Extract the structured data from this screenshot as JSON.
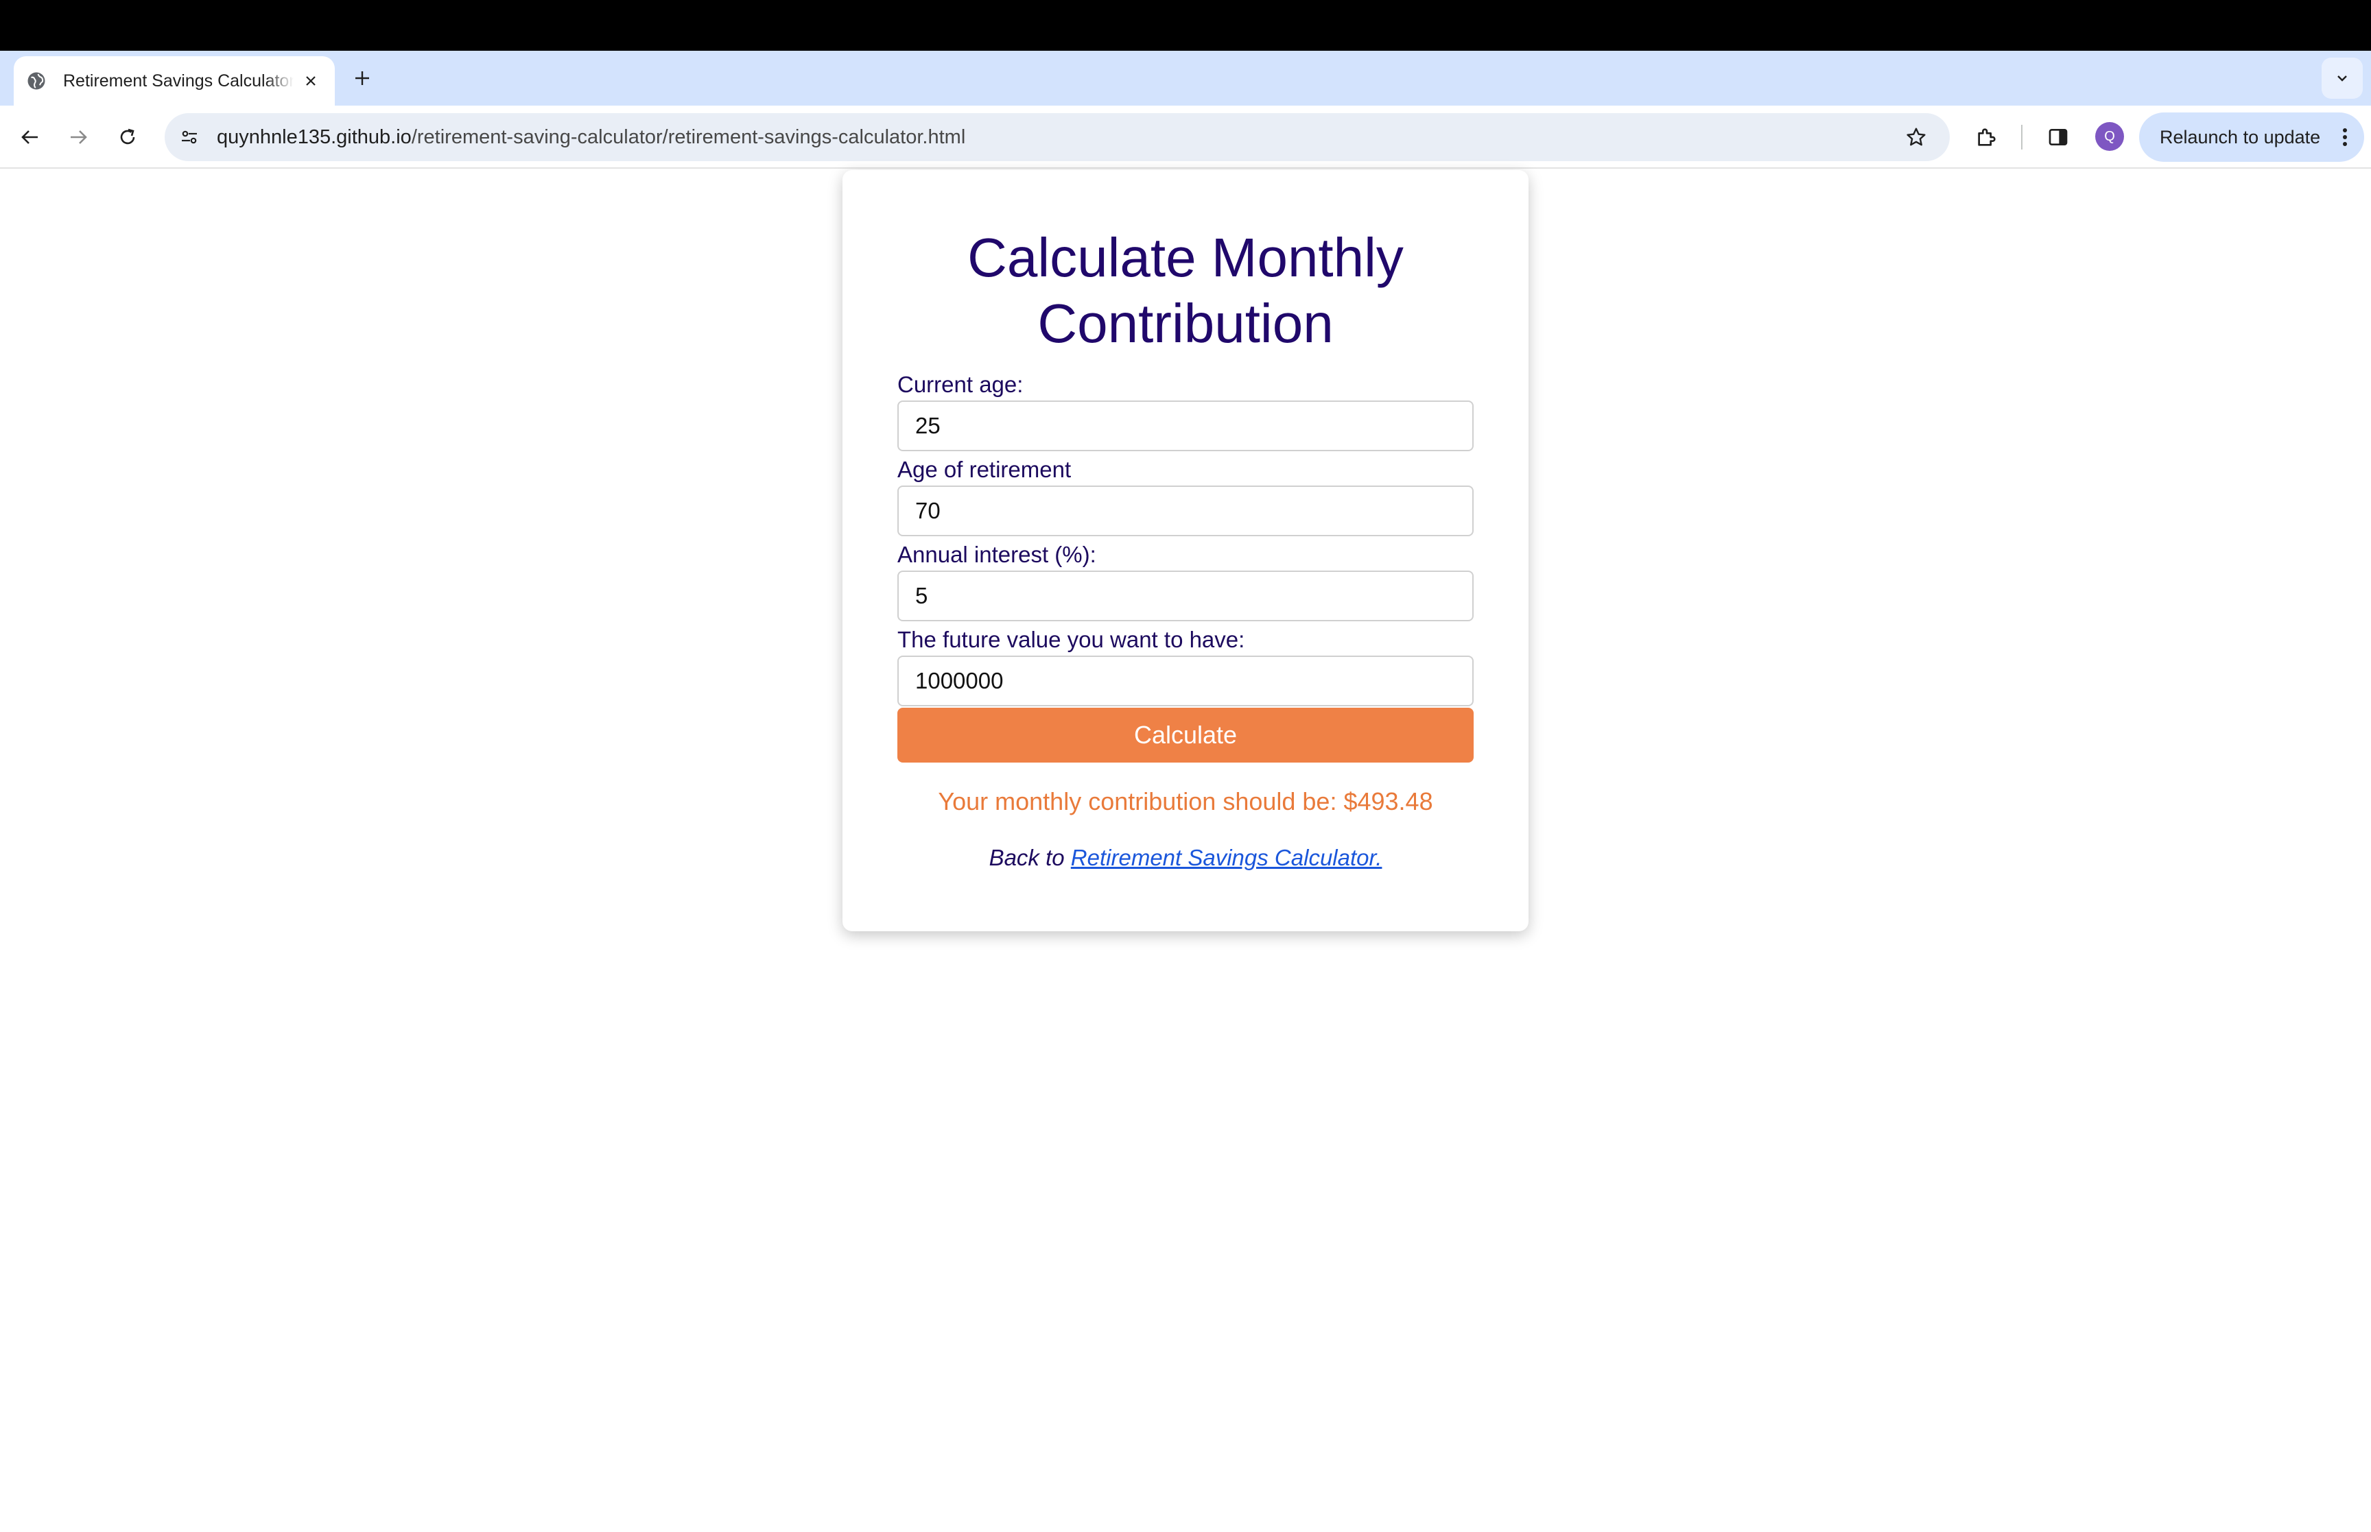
{
  "browser": {
    "tab": {
      "title": "Retirement Savings Calculator",
      "close_icon": "close-icon",
      "favicon": "globe-icon"
    },
    "new_tab_icon": "plus-icon",
    "tab_search_icon": "chevron-down-icon",
    "toolbar": {
      "url_host": "quynhnle135.github.io",
      "url_path": "/retirement-saving-calculator/retirement-savings-calculator.html",
      "relaunch_label": "Relaunch to update",
      "profile_initial": "Q"
    }
  },
  "page": {
    "title": "Calculate Monthly Contribution",
    "fields": [
      {
        "label": "Current age:",
        "value": "25"
      },
      {
        "label": "Age of retirement",
        "value": "70"
      },
      {
        "label": "Annual interest (%):",
        "value": "5"
      },
      {
        "label": "The future value you want to have:",
        "value": "1000000"
      }
    ],
    "button_label": "Calculate",
    "result_text": "Your monthly contribution should be: $493.48",
    "back_prefix": "Back to ",
    "back_link_text": "Retirement Savings Calculator."
  },
  "colors": {
    "title": "#20086b",
    "button": "#ef8146",
    "result": "#e97a3a",
    "link": "#1a56db"
  }
}
